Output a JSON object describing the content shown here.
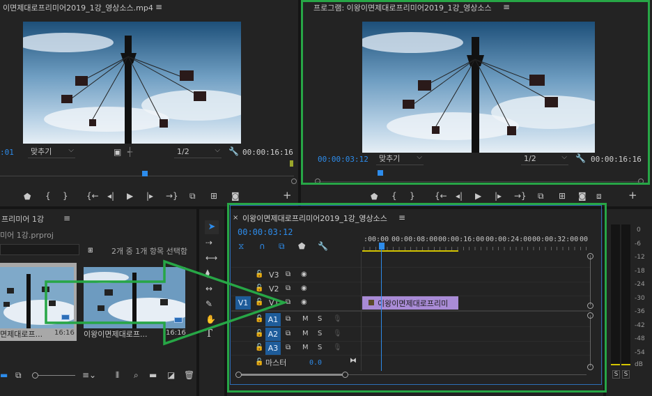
{
  "source_monitor": {
    "title": "이면제대로프리미어2019_1강_영상소스.mp4",
    "timecode_left": ":01",
    "fit": "맞추기",
    "resolution": "1/2",
    "duration": "00:00:16:16"
  },
  "program_monitor": {
    "title": "프로그램: 이왕이면제대로프리미어2019_1강_영상소스",
    "timecode": "00:00:03:12",
    "fit": "맞추기",
    "resolution": "1/2",
    "duration": "00:00:16:16"
  },
  "project_panel": {
    "title": "프리미어 1강",
    "filename": "미어 1강.prproj",
    "selection": "2개 중 1개 항목 선택함",
    "items": [
      {
        "name": "면제대로프...",
        "duration": "16:16"
      },
      {
        "name": "이왕이면제대로프...",
        "duration": "16:16"
      }
    ]
  },
  "timeline": {
    "tab_title": "이왕이면제대로프리미어2019_1강_영상소스",
    "timecode": "00:00:03:12",
    "ruler": [
      ":00:00",
      "00:00:08:00",
      "00:00:16:00",
      "00:00:24:00",
      "00:00:32:00",
      "00"
    ],
    "tracks": {
      "v3": "V3",
      "v2": "V2",
      "v1": "V1",
      "v1_target": "V1",
      "a1": "A1",
      "a2": "A2",
      "a3": "A3",
      "master": "마스터",
      "master_value": "0.0",
      "m": "M",
      "s": "S"
    },
    "clip_label": "이왕이면제대로프리미"
  },
  "meter": {
    "labels": [
      "0",
      "-6",
      "-12",
      "-18",
      "-24",
      "-30",
      "-36",
      "-42",
      "-48",
      "-54",
      "dB"
    ],
    "solo": "S"
  },
  "colors": {
    "accent_green": "#27a646",
    "timecode_blue": "#2d8ceb",
    "clip_purple": "#a98bd6"
  },
  "icons": {
    "type_tool": "T"
  }
}
